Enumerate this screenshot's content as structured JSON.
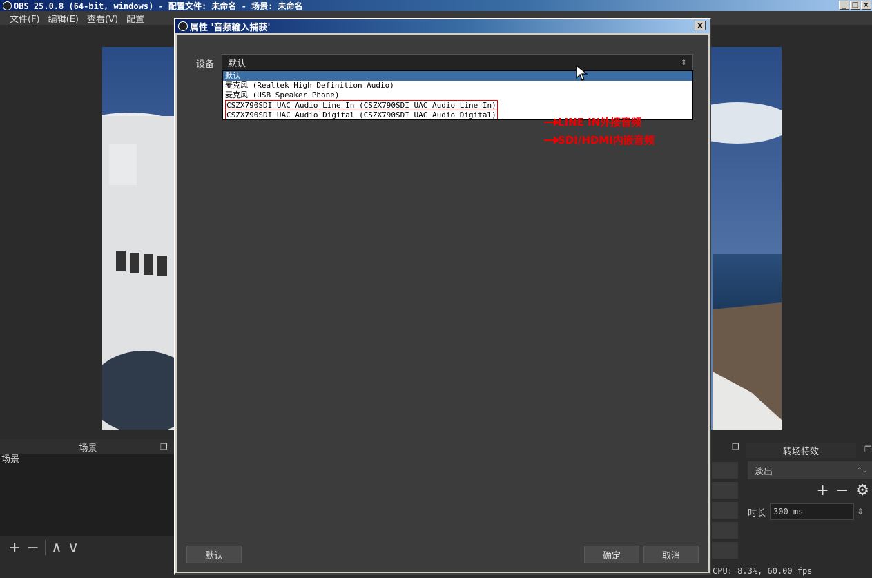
{
  "main_window": {
    "title": "OBS 25.0.8 (64-bit, windows) - 配置文件: 未命名 - 场景: 未命名",
    "menu": [
      "文件(F)",
      "编辑(E)",
      "查看(V)",
      "配置"
    ]
  },
  "scenes_dock": {
    "title": "场景",
    "items": [
      "场景"
    ],
    "tool_add": "+",
    "tool_remove": "−",
    "tool_up": "∧",
    "tool_down": "∨"
  },
  "transitions_dock": {
    "title": "转场特效",
    "selected": "淡出",
    "duration_label": "时长",
    "duration_value": "300 ms"
  },
  "status": {
    "cpu": "CPU: 8.3%, 60.00 fps"
  },
  "dialog": {
    "title": "属性 '音频输入捕获'",
    "close_label": "X",
    "device_label": "设备",
    "device_selected": "默认",
    "options": [
      "默认",
      "麦克风 (Realtek High Definition Audio)",
      "麦克风 (USB Speaker Phone)",
      "CSZX790SDI UAC Audio Line In (CSZX790SDI UAC Audio Line In)",
      "CSZX790SDI UAC Audio Digital (CSZX790SDI UAC Audio Digital)"
    ],
    "annotations": [
      "LINE IN外接音频",
      "SDI/HDMI内嵌音频"
    ],
    "btn_defaults": "默认",
    "btn_ok": "确定",
    "btn_cancel": "取消"
  },
  "colors": {
    "annotation": "#e00000",
    "selection": "#3a6ea5"
  }
}
